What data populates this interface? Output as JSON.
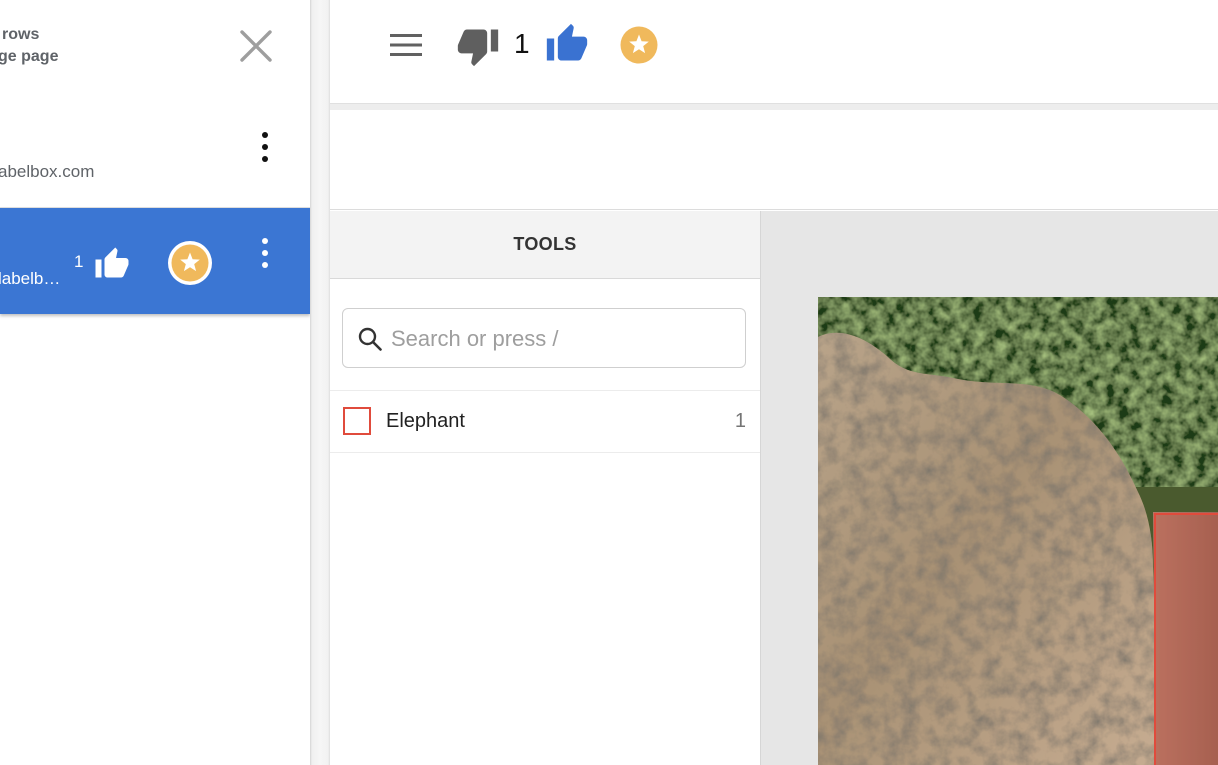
{
  "drawer": {
    "header_line1": "rows",
    "header_line2": "ge page",
    "rows": [
      {
        "email": "abelbox.com"
      },
      {
        "email": "labelb…",
        "likes": "1"
      }
    ]
  },
  "toolbar": {
    "score": "1"
  },
  "tools": {
    "title": "TOOLS",
    "search_placeholder": "Search or press /",
    "items": [
      {
        "name": "Elephant",
        "count": "1",
        "color": "#e04b3c"
      }
    ]
  },
  "colors": {
    "selected_row": "#3b76d3",
    "like": "#3a72d1",
    "dislike": "#5f5f5f",
    "favorite": "#f0b95c",
    "annotation": "#e04b3c"
  },
  "icons": {
    "close": "close-icon",
    "menu": "menu-icon",
    "dislike": "thumb-down-icon",
    "like": "thumb-up-icon",
    "favorite": "star-icon",
    "more": "more-vertical-icon",
    "search": "search-icon"
  }
}
